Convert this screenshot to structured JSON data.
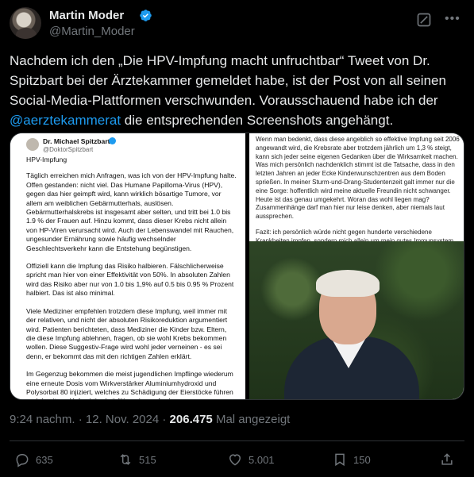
{
  "author": {
    "name": "Martin Moder",
    "handle": "@Martin_Moder"
  },
  "tweet": {
    "text_before": "Nachdem ich den „Die HPV-Impfung macht unfruchtbar“ Tweet von Dr. Spitzbart bei der Ärztekammer gemeldet habe, ist der Post von all seinen Social-Media-Plattformen verschwunden. Vorausschauend habe ich der ",
    "mention": "@aerztekammerat",
    "text_after": " die entsprechenden Screenshots angehängt."
  },
  "screenshot_left": {
    "name": "Dr. Michael Spitzbart",
    "handle": "@DoktorSpitzbart",
    "subtitle": "HPV-Impfung",
    "paragraphs": [
      "Täglich erreichen mich Anfragen, was ich von der HPV-Impfung halte. Offen gestanden: nicht viel. Das Humane Papilloma-Virus (HPV), gegen das hier geimpft wird, kann wirklich bösartige Tumore, vor allem am weiblichen Gebärmutterhals, auslösen. Gebärmutterhalskrebs ist insgesamt aber selten, und tritt bei 1.0 bis 1.9 % der Frauen auf. Hinzu kommt, dass dieser Krebs nicht allein von HP-Viren verursacht wird. Auch der Lebenswandel mit Rauchen, ungesunder Ernährung sowie häufig wechselnder Geschlechtsverkehr kann die Entstehung begünstigen.",
      "Offiziell kann die Impfung das Risiko halbieren. Fälschlicherweise spricht man hier von einer Effektivität von 50%. In absoluten Zahlen wird das Risiko aber nur von 1.0 bis 1,9% auf 0.5 bis 0.95 % Prozent halbiert. Das ist also minimal.",
      "Viele Mediziner empfehlen trotzdem diese Impfung, weil immer mit der relativen, und nicht der absoluten Risikoreduktion argumentiert wird. Patienten berichteten, dass Mediziner die Kinder bzw. Eltern, die diese Impfung ablehnen, fragen, ob sie wohl Krebs bekommen wollen. Diese Suggestiv-Frage wird wohl jeder verneinen - es sei denn, er bekommt das mit den richtigen Zahlen erklärt.",
      "Im Gegenzug bekommen die meist jugendlichen Impflinge wiederum eine erneute Dosis vom Wirkverstärker Aluminiumhydroxid und Polysorbat 80 injiziert, welches zu Schädigung der Eierstöcke führen und damit zur Unfruchtbarkeit führen kann. Auch Autoimmunkrankheiten, chronisch entzündliche Darmerkrankungen, neurologische Störungen bis hin zur Multiplen Sklerose können als Nebenwirkungen auftreten."
    ]
  },
  "screenshot_right": {
    "paragraphs": [
      "Wenn man bedenkt, dass diese angeblich so effektive Impfung seit 2006 angewandt wird, die Krebsrate aber trotzdem jährlich um 1,3 % steigt, kann sich jeder seine eigenen Gedanken über die Wirksamkeit machen. Was mich persönlich nachdenklich stimmt ist die Tatsache, dass in den letzten Jahren an jeder Ecke Kinderwunschzentren aus dem Boden sprießen. In meiner Sturm-und-Drang-Studentenzeit galt immer nur die eine Sorge: hoffentlich wird meine aktuelle Freundin nicht schwanger. Heute ist das genau umgekehrt. Woran das wohl liegen mag? Zusammenhänge darf man hier nur leise denken, aber niemals laut aussprechen.",
      "Fazit: ich persönlich würde nicht gegen hunderte verschiedene Krankheiten impfen, sondern mich allein um mein gutes Immunsystem kümmern - und dieses nicht an die Impfindustrie outsourcen."
    ]
  },
  "meta": {
    "time": "9:24 nachm.",
    "dot1": " · ",
    "date": "12. Nov. 2024",
    "dot2": " · ",
    "views": "206.475",
    "views_label": " Mal angezeigt"
  },
  "actions": {
    "replies": "635",
    "reposts": "515",
    "likes": "5.001",
    "bookmarks": "150"
  },
  "icons": [
    "verified-badge-icon",
    "grok-icon",
    "more-icon",
    "reply-icon",
    "repost-icon",
    "like-icon",
    "bookmark-icon",
    "share-icon"
  ],
  "colors": {
    "background": "#000000",
    "text": "#e7e9ea",
    "muted": "#71767b",
    "accent": "#1d9bf0"
  }
}
